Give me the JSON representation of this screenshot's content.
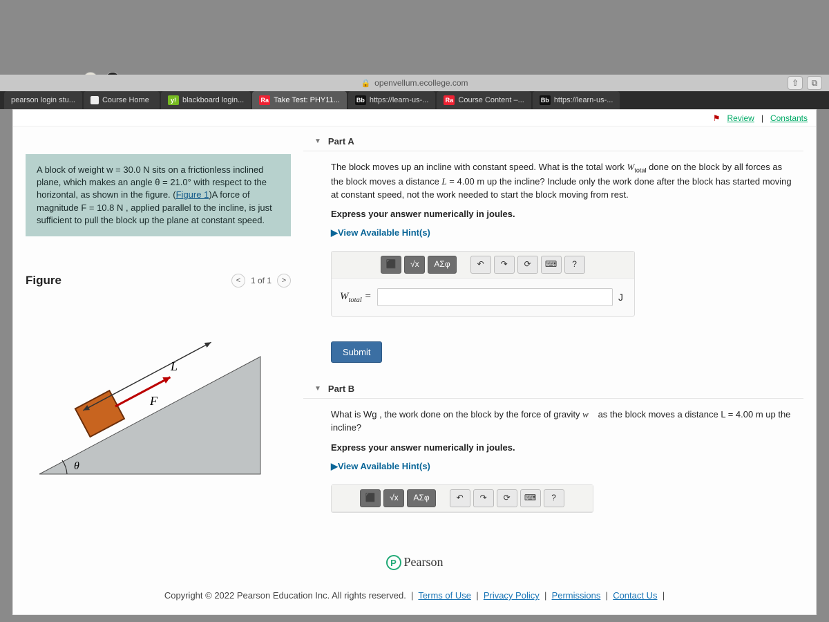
{
  "chrome": {
    "url": "openvellum.ecollege.com",
    "share_icon": "share",
    "newtab_icon": "new-tab"
  },
  "tabs": [
    {
      "label": "pearson login stu...",
      "badge": ""
    },
    {
      "label": "Course Home",
      "badge": "doc"
    },
    {
      "label": "blackboard login...",
      "badge": "y"
    },
    {
      "label": "Take Test: PHY11...",
      "badge": "Ra",
      "active": true
    },
    {
      "label": "https://learn-us-...",
      "badge": "Bb"
    },
    {
      "label": "Course Content –...",
      "badge": "Ra"
    },
    {
      "label": "https://learn-us-...",
      "badge": "Bb"
    }
  ],
  "top_links": {
    "review": "Review",
    "constants": "Constants"
  },
  "problem_text": {
    "l1": "A block of weight w = 30.0 N sits on a frictionless inclined plane, which makes an angle θ = 21.0° with respect to the horizontal, as shown in the figure. (",
    "figure_link": "Figure 1",
    "l2": ")A force of magnitude F = 10.8 N , applied parallel to the incline, is just sufficient to pull the block up the plane at constant speed."
  },
  "figure": {
    "title": "Figure",
    "pager": "1 of 1",
    "labels": {
      "L": "L",
      "F": "F",
      "theta": "θ"
    }
  },
  "partA": {
    "title": "Part A",
    "question": "The block moves up an incline with constant speed. What is the total work Wtotal done on the block by all forces as the block moves a distance L = 4.00 m up the incline? Include only the work done after the block has started moving at constant speed, not the work needed to start the block moving from rest.",
    "instruction": "Express your answer numerically in joules.",
    "hints": "View Available Hint(s)",
    "toolbar": {
      "templates": "⬛",
      "sqrt": "√x",
      "greek": "ΑΣφ",
      "undo": "↶",
      "redo": "↷",
      "reset": "⟳",
      "keyboard": "⌨",
      "help": "?"
    },
    "answer_label": "Wtotal =",
    "answer_value": "",
    "unit": "J",
    "submit": "Submit"
  },
  "partB": {
    "title": "Part B",
    "question_a": "What is Wg , the work done on the block by the force of gravity ",
    "question_b": " as the block moves a distance L = 4.00 m up the incline?",
    "w_vec": "w⃗",
    "instruction": "Express your answer numerically in joules.",
    "hints": "View Available Hint(s)",
    "toolbar": {
      "templates": "⬛",
      "sqrt": "√x",
      "greek": "ΑΣφ",
      "undo": "↶",
      "redo": "↷",
      "reset": "⟳",
      "keyboard": "⌨",
      "help": "?"
    }
  },
  "brand": "Pearson",
  "footer": {
    "copyright": "Copyright © 2022 Pearson Education Inc. All rights reserved.",
    "links": [
      "Terms of Use",
      "Privacy Policy",
      "Permissions",
      "Contact Us"
    ]
  }
}
